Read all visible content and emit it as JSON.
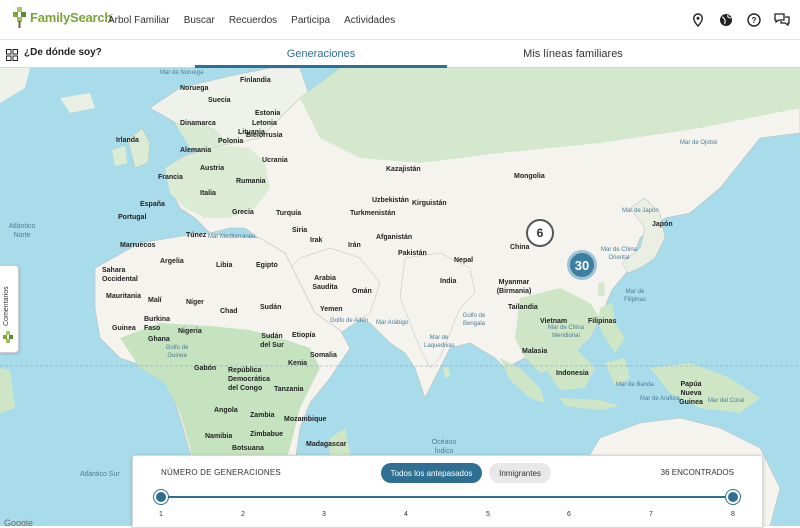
{
  "app": {
    "logo_text": "FamilySearch"
  },
  "nav": {
    "links": [
      "Árbol Familiar",
      "Buscar",
      "Recuerdos",
      "Participa",
      "Actividades"
    ]
  },
  "subheader": {
    "title": "¿De dónde soy?",
    "tabs": [
      {
        "label": "Generaciones",
        "active": true
      },
      {
        "label": "Mis líneas familiares",
        "active": false
      }
    ]
  },
  "feedback": {
    "label": "Comentarios"
  },
  "map": {
    "countries": [
      "Finlandia",
      "Noruega",
      "Suecia",
      "Estonia",
      "Letonia",
      "Dinamarca",
      "Lituania",
      "Irlanda",
      "Bielorrusia",
      "Alemania",
      "Polonia",
      "Ucrania",
      "Francia",
      "Austria",
      "Rumania",
      "España",
      "Italia",
      "Grecia",
      "Turquía",
      "Portugal",
      "Túnez",
      "Marruecos",
      "Argelia",
      "Libia",
      "Egipto",
      "Sahara Occidental",
      "Mauritania",
      "Malí",
      "Níger",
      "Chad",
      "Sudán",
      "Burkina Faso",
      "Guinea",
      "Nigeria",
      "Ghana",
      "Etiopía",
      "Sudán del Sur",
      "Somalia",
      "Kenia",
      "Gabón",
      "República Democrática del Congo",
      "Tanzania",
      "Angola",
      "Zambia",
      "Mozambique",
      "Namibia",
      "Zimbabue",
      "Botsuana",
      "Madagascar",
      "Siria",
      "Irak",
      "Irán",
      "Arabia Saudita",
      "Omán",
      "Yemen",
      "Kazajistán",
      "Uzbekistán",
      "Turkmenistán",
      "Kirguistán",
      "Afganistán",
      "Pakistán",
      "India",
      "Nepal",
      "Mongolia",
      "China",
      "Myanmar (Birmania)",
      "Tailandia",
      "Vietnam",
      "Malasia",
      "Filipinas",
      "Indonesia",
      "Japón",
      "Papúa Nueva Guinea"
    ],
    "seas": [
      "Mar de Noruega",
      "Mar Mediterráneo",
      "Mar Arábigo",
      "Golfo de Adén",
      "Golfo de Bengala",
      "Mar de Laquedivas",
      "Mar de Japón",
      "Mar de Ojotsk",
      "Mar de China Oriental",
      "Mar de Filipinas",
      "Golfo de Guinea",
      "Mar de China Meridional",
      "Mar de Banda",
      "Mar de Arafura",
      "Mar del Coral"
    ],
    "oceans": [
      "Atlántico Norte",
      "Océano Índico",
      "Atlántico Sur"
    ],
    "clusters": [
      {
        "count": "6"
      },
      {
        "count": "30"
      }
    ],
    "attribution": "Google"
  },
  "panel": {
    "label": "NÚMERO DE GENERACIONES",
    "filter_all": "Todos los antepasados",
    "filter_immigrants": "Inmigrantes",
    "found": "36 ENCONTRADOS",
    "ticks": [
      "1",
      "2",
      "3",
      "4",
      "5",
      "6",
      "7",
      "8"
    ],
    "range": {
      "min": 1,
      "max": 8
    }
  },
  "colors": {
    "accent": "#2f6f92",
    "brand_green": "#7aa637",
    "water": "#a9dcea",
    "land": "#f4f3ee",
    "green_land": "#c6e3c0"
  }
}
